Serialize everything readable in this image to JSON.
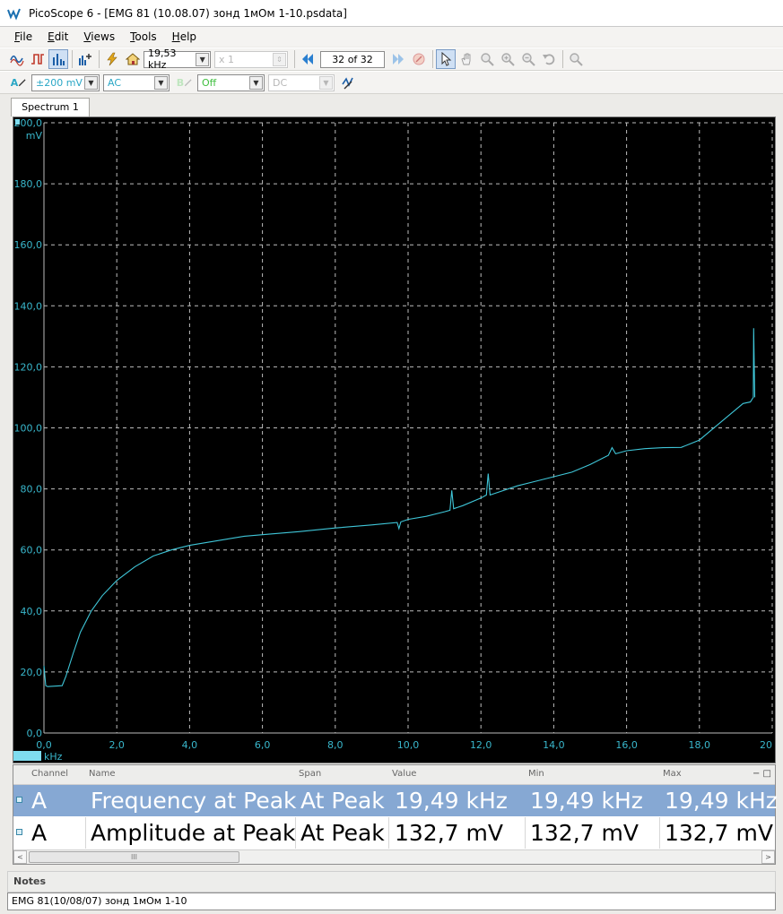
{
  "window": {
    "title": "PicoScope 6 - [EMG 81 (10.08.07) зонд 1мОм 1-10.psdata]"
  },
  "menu": [
    "File",
    "Edit",
    "Views",
    "Tools",
    "Help"
  ],
  "toolbar1": {
    "frequency_value": "19,53 kHz",
    "multiplier_value": "x 1",
    "buffer_position": "32",
    "buffer_of": "of",
    "buffer_total": "32"
  },
  "toolbar2": {
    "channel_a_label": "A",
    "channel_a_range": "±200 mV",
    "channel_a_coupling": "AC",
    "channel_b_label": "B",
    "channel_b_range": "Off",
    "channel_b_coupling": "DC"
  },
  "tabs": [
    "Spectrum 1"
  ],
  "chart_data": {
    "type": "line",
    "xlabel": "kHz",
    "ylabel": "mV",
    "xlim": [
      0,
      20
    ],
    "ylim": [
      0,
      200
    ],
    "x_ticks": [
      "0,0",
      "2,0",
      "4,0",
      "6,0",
      "8,0",
      "10,0",
      "12,0",
      "14,0",
      "16,0",
      "18,0",
      "20"
    ],
    "y_ticks": [
      "0,0",
      "20,0",
      "40,0",
      "60,0",
      "80,0",
      "100,0",
      "120,0",
      "140,0",
      "160,0",
      "180,0",
      "200,0"
    ],
    "grid": true,
    "colors": {
      "background": "#000000",
      "trace": "#3fc6d8",
      "grid": "#bdbdbd",
      "axis_text": "#39b7cc"
    },
    "series": [
      {
        "x": [
          0.0,
          0.05,
          0.1,
          0.5,
          0.6,
          0.8,
          1.0,
          1.3,
          1.6,
          2.0,
          2.5,
          3.0,
          3.5,
          4.0,
          4.5,
          5.0,
          5.5,
          6.0,
          7.0,
          8.0,
          9.0,
          9.7,
          9.75,
          9.8,
          10.0,
          10.5,
          11.0,
          11.15,
          11.2,
          11.25,
          11.5,
          12.0,
          12.15,
          12.2,
          12.25,
          12.5,
          13.0,
          13.5,
          14.0,
          14.5,
          15.0,
          15.5,
          15.6,
          15.7,
          16.0,
          16.5,
          17.0,
          17.5,
          18.0,
          18.5,
          19.0,
          19.2,
          19.4,
          19.48,
          19.49,
          19.52
        ],
        "y": [
          22.0,
          15.5,
          15.2,
          15.5,
          18.5,
          26.0,
          33.0,
          40.0,
          45.0,
          50.0,
          54.5,
          58.0,
          60.0,
          61.5,
          62.5,
          63.5,
          64.5,
          65.0,
          66.0,
          67.2,
          68.2,
          69.0,
          67.0,
          69.2,
          70.0,
          71.0,
          72.5,
          73.0,
          79.5,
          73.5,
          74.5,
          77.0,
          78.0,
          85.0,
          78.0,
          79.0,
          81.0,
          82.5,
          84.0,
          85.5,
          88.0,
          91.0,
          93.5,
          91.5,
          92.5,
          93.2,
          93.5,
          93.6,
          96.0,
          101.0,
          106.0,
          108.0,
          108.5,
          110.0,
          132.7,
          110.0
        ]
      }
    ]
  },
  "measurements": {
    "headers": [
      "Channel",
      "Name",
      "Span",
      "Value",
      "Min",
      "Max"
    ],
    "header_tools": "− □",
    "rows": [
      {
        "channel": "A",
        "name": "Frequency at Peak",
        "span": "At Peak",
        "value": "19,49 kHz",
        "min": "19,49 kHz",
        "max": "19,49 kHz"
      },
      {
        "channel": "A",
        "name": "Amplitude at Peak",
        "span": "At Peak",
        "value": "132,7 mV",
        "min": "132,7 mV",
        "max": "132,7 mV"
      }
    ],
    "scroll_left": "<",
    "scroll_right": ">",
    "scroll_thumb": "III"
  },
  "notes": {
    "label": "Notes",
    "text": "EMG 81(10/08/07) зонд 1мОм 1-10"
  }
}
